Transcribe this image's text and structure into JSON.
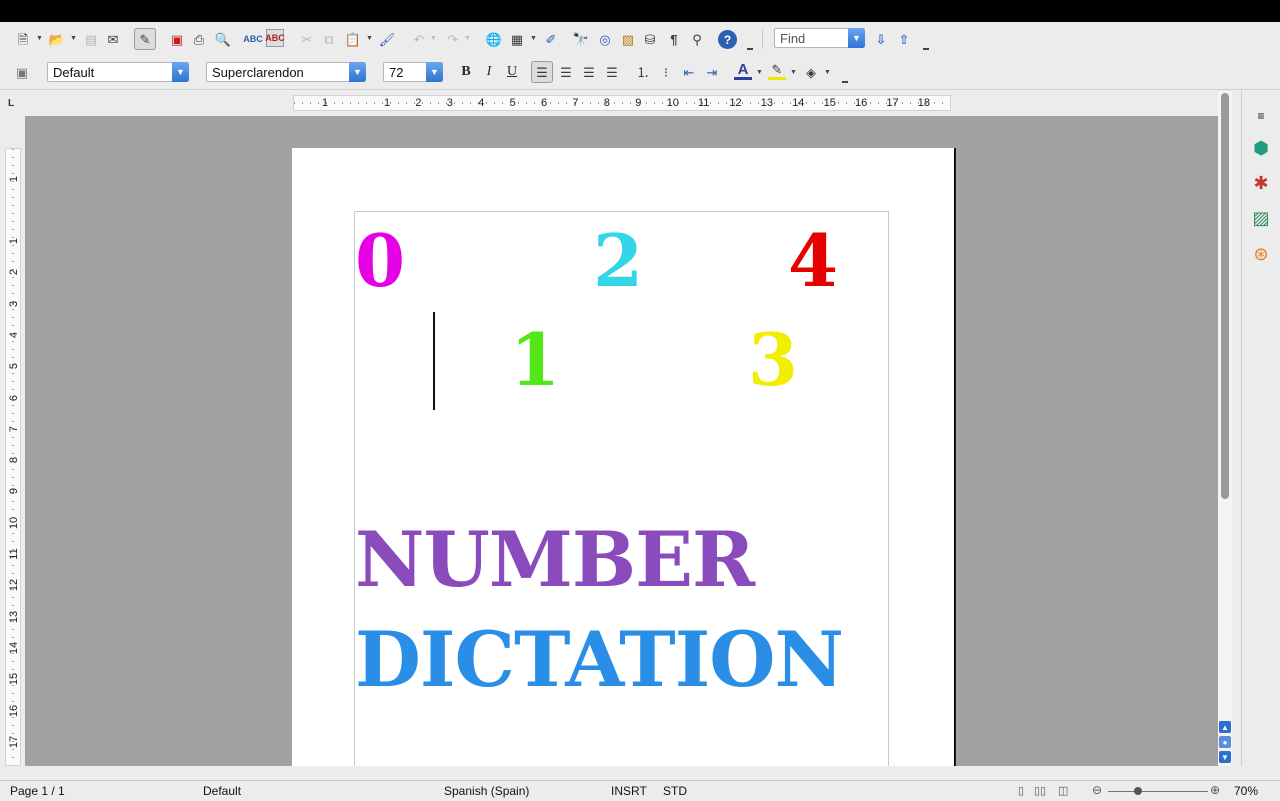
{
  "toolbar_standard": {
    "icons": [
      "new-document-icon",
      "open-icon",
      "save-icon",
      "email-icon",
      "edit-mode-icon",
      "export-pdf-icon",
      "print-icon",
      "print-preview-icon",
      "spellcheck-icon",
      "autospellcheck-icon",
      "cut-icon",
      "copy-icon",
      "paste-icon",
      "format-paintbrush-icon",
      "undo-icon",
      "redo-icon",
      "hyperlink-icon",
      "table-icon",
      "draw-functions-icon",
      "find-replace-icon",
      "navigator-icon",
      "gallery-icon",
      "data-sources-icon",
      "formatting-marks-icon",
      "zoom-icon",
      "help-icon",
      "find-next-icon",
      "find-previous-icon"
    ],
    "find_placeholder": "Find"
  },
  "toolbar_formatting": {
    "paragraph_style": "Default",
    "font_name": "Superclarendon",
    "font_size": "72",
    "bold_label": "B",
    "italic_label": "I",
    "underline_label": "U"
  },
  "ruler": {
    "horizontal_ticks": [
      "1",
      "1",
      "2",
      "3",
      "4",
      "5",
      "6",
      "7",
      "8",
      "9",
      "10",
      "11",
      "12",
      "13",
      "14",
      "15",
      "16",
      "17",
      "18"
    ],
    "vertical_ticks": [
      "1",
      "1",
      "2",
      "3",
      "4",
      "5",
      "6",
      "7",
      "8",
      "9",
      "10",
      "11",
      "12",
      "13",
      "14",
      "15",
      "16",
      "17"
    ]
  },
  "document": {
    "digits": [
      {
        "text": "0",
        "color": "#e600e6"
      },
      {
        "text": "2",
        "color": "#33d6e6"
      },
      {
        "text": "4",
        "color": "#e60000"
      },
      {
        "text": "1",
        "color": "#55e61a"
      },
      {
        "text": "3",
        "color": "#f2ee00"
      }
    ],
    "title_line1": {
      "text": "NUMBER",
      "color": "#8a4bbd"
    },
    "title_line2": {
      "text": "DICTATION",
      "color": "#2a8ee6"
    }
  },
  "sidebar": {
    "icons": [
      "properties-icon",
      "styles-icon",
      "gallery-icon",
      "navigator-icon"
    ]
  },
  "statusbar": {
    "page": "Page 1 / 1",
    "page_style": "Default",
    "language": "Spanish (Spain)",
    "insert_mode": "INSRT",
    "selection_mode": "STD",
    "zoom": "70%"
  },
  "colors": {
    "accent": "#2f74d6",
    "workspace": "#a1a1a1"
  }
}
